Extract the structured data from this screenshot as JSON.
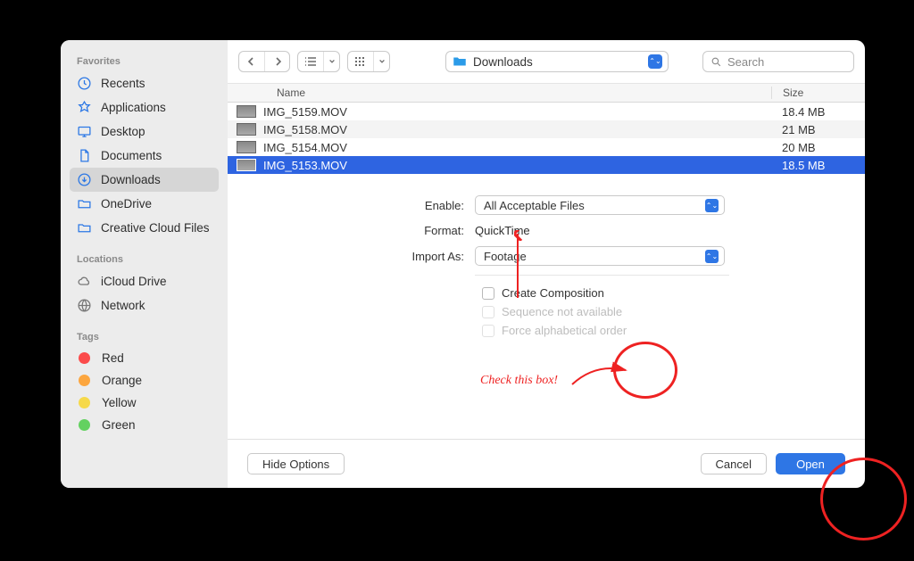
{
  "sidebar": {
    "sections": [
      {
        "title": "Favorites",
        "items": [
          {
            "label": "Recents"
          },
          {
            "label": "Applications"
          },
          {
            "label": "Desktop"
          },
          {
            "label": "Documents"
          },
          {
            "label": "Downloads",
            "selected": true
          },
          {
            "label": "OneDrive"
          },
          {
            "label": "Creative Cloud Files"
          }
        ]
      },
      {
        "title": "Locations",
        "items": [
          {
            "label": "iCloud Drive"
          },
          {
            "label": "Network"
          }
        ]
      },
      {
        "title": "Tags",
        "items": [
          {
            "label": "Red",
            "color": "#fb4b4b"
          },
          {
            "label": "Orange",
            "color": "#fca63f"
          },
          {
            "label": "Yellow",
            "color": "#f6d94a"
          },
          {
            "label": "Green",
            "color": "#63d160"
          }
        ]
      }
    ]
  },
  "toolbar": {
    "folder_name": "Downloads",
    "search_placeholder": "Search"
  },
  "columns": {
    "name": "Name",
    "size": "Size"
  },
  "files": [
    {
      "name": "IMG_5159.MOV",
      "size": "18.4 MB"
    },
    {
      "name": "IMG_5158.MOV",
      "size": "21 MB"
    },
    {
      "name": "IMG_5154.MOV",
      "size": "20 MB"
    },
    {
      "name": "IMG_5153.MOV",
      "size": "18.5 MB",
      "selected": true
    }
  ],
  "options": {
    "enable_label": "Enable:",
    "enable_value": "All Acceptable Files",
    "format_label": "Format:",
    "format_value": "QuickTime",
    "import_label": "Import As:",
    "import_value": "Footage",
    "checkboxes": {
      "create_composition": "Create Composition",
      "sequence_not_available": "Sequence not available",
      "force_alpha": "Force alphabetical order"
    }
  },
  "footer": {
    "hide_options": "Hide Options",
    "cancel": "Cancel",
    "open": "Open"
  },
  "annotations": {
    "check_this_box": "Check this box!"
  }
}
